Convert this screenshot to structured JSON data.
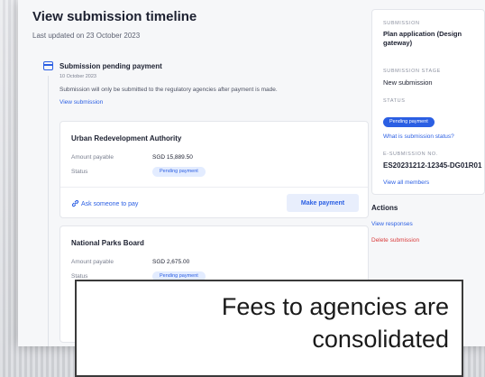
{
  "header": {
    "title": "View submission timeline",
    "updated": "Last updated on 23 October 2023"
  },
  "event": {
    "title": "Submission pending payment",
    "date": "10 October 2023",
    "description": "Submission will only be submitted to the regulatory agencies after payment is made.",
    "link": "View submission"
  },
  "cards": [
    {
      "agency": "Urban Redevelopment Authority",
      "amount_label": "Amount payable",
      "amount": "SGD 15,889.50",
      "status_label": "Status",
      "status": "Pending payment",
      "ask_label": "Ask someone to pay",
      "pay_label": "Make payment"
    },
    {
      "agency": "National Parks Board",
      "amount_label": "Amount payable",
      "amount": "SGD 2,675.00",
      "status_label": "Status",
      "status": "Pending payment"
    }
  ],
  "sidebar": {
    "submission_label": "SUBMISSION",
    "submission": "Plan application (Design gateway)",
    "stage_label": "SUBMISSION STAGE",
    "stage": "New submission",
    "status_label": "STATUS",
    "status": "Pending payment",
    "status_link": "What is submission status?",
    "esub_label": "E-SUBMISSION NO.",
    "esub": "ES20231212-12345-DG01R01",
    "members_link": "View all members"
  },
  "actions": {
    "heading": "Actions",
    "view": "View responses",
    "delete": "Delete submission"
  },
  "callout": {
    "text": "Fees to agencies are consolidated"
  },
  "colors": {
    "accent": "#2b5fe3",
    "danger": "#d93b3b"
  }
}
